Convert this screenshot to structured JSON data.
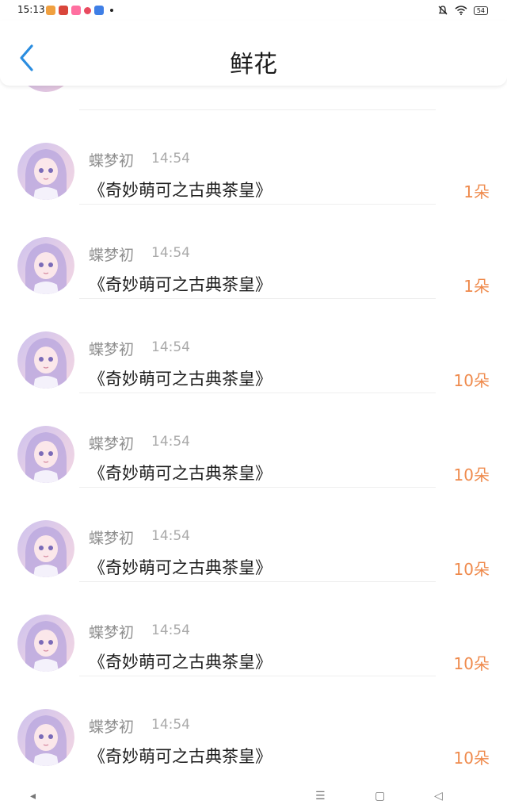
{
  "status_bar": {
    "time": "15:13",
    "battery": "54",
    "app_icons": [
      "#f0a040",
      "#d9463b",
      "#ff6fa0",
      "#e84a5f",
      "#3f7fe6"
    ]
  },
  "header": {
    "title": "鲜花",
    "accent_color": "#2a8de0"
  },
  "records": [
    {
      "name": "蝶梦初",
      "time": "14:54",
      "gift": "《奇妙萌可之古典茶皇》",
      "count": "1朵"
    },
    {
      "name": "蝶梦初",
      "time": "14:54",
      "gift": "《奇妙萌可之古典茶皇》",
      "count": "1朵"
    },
    {
      "name": "蝶梦初",
      "time": "14:54",
      "gift": "《奇妙萌可之古典茶皇》",
      "count": "10朵"
    },
    {
      "name": "蝶梦初",
      "time": "14:54",
      "gift": "《奇妙萌可之古典茶皇》",
      "count": "10朵"
    },
    {
      "name": "蝶梦初",
      "time": "14:54",
      "gift": "《奇妙萌可之古典茶皇》",
      "count": "10朵"
    },
    {
      "name": "蝶梦初",
      "time": "14:54",
      "gift": "《奇妙萌可之古典茶皇》",
      "count": "10朵"
    },
    {
      "name": "蝶梦初",
      "time": "14:54",
      "gift": "《奇妙萌可之古典茶皇》",
      "count": "10朵"
    }
  ],
  "count_color": "#ef8a4c"
}
